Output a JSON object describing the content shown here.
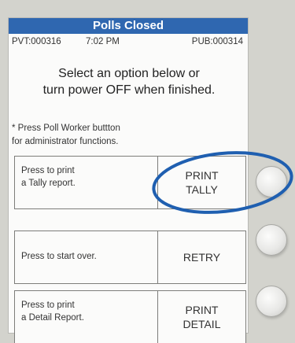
{
  "screen": {
    "title": "Polls Closed",
    "info": {
      "pvt": "PVT:000316",
      "time": "7:02 PM",
      "pub": "PUB:000314"
    },
    "instruction_line1": "Select an option below or",
    "instruction_line2": "turn power OFF when finished.",
    "note_line1": "* Press Poll Worker buttton",
    "note_line2": "for administrator functions.",
    "options": [
      {
        "desc_line1": "Press to print",
        "desc_line2": "a Tally report.",
        "action_line1": "PRINT",
        "action_line2": "TALLY"
      },
      {
        "desc_line1": "Press to start over.",
        "desc_line2": "",
        "action_line1": "RETRY",
        "action_line2": ""
      },
      {
        "desc_line1": "Press to print",
        "desc_line2": "a Detail Report.",
        "action_line1": "PRINT",
        "action_line2": "DETAIL"
      }
    ]
  },
  "colors": {
    "title_bar": "#2f67b0",
    "highlight_ellipse": "#1f5fb0",
    "bezel": "#d3d3cd"
  },
  "highlight": {
    "target": "print-tally-option",
    "shape": "ellipse"
  }
}
